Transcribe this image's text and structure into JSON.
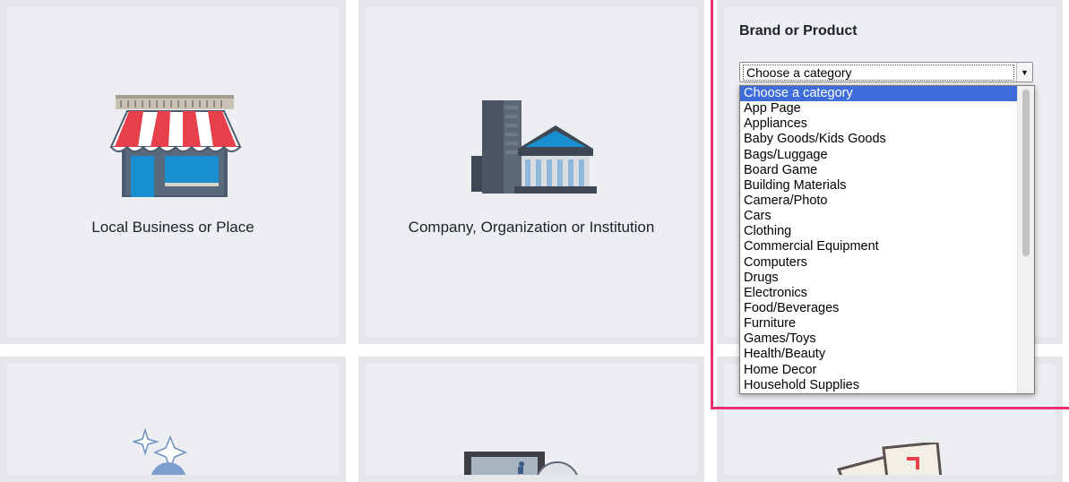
{
  "tiles": {
    "local_business": {
      "label": "Local Business or Place"
    },
    "company": {
      "label": "Company, Organization or Institution"
    }
  },
  "brand_panel": {
    "title": "Brand or Product",
    "select": {
      "selected": "Choose a category",
      "options": [
        "Choose a category",
        "App Page",
        "Appliances",
        "Baby Goods/Kids Goods",
        "Bags/Luggage",
        "Board Game",
        "Building Materials",
        "Camera/Photo",
        "Cars",
        "Clothing",
        "Commercial Equipment",
        "Computers",
        "Drugs",
        "Electronics",
        "Food/Beverages",
        "Furniture",
        "Games/Toys",
        "Health/Beauty",
        "Home Decor",
        "Household Supplies"
      ]
    }
  },
  "colors": {
    "highlight": "#e8306f",
    "selected_option": "#3e6ddb",
    "tile_background": "#eceef1"
  },
  "icons": [
    "storefront-icon",
    "institution-building-icon",
    "sparkle-moon-icon",
    "video-screen-icon",
    "greeting-cards-icon"
  ]
}
